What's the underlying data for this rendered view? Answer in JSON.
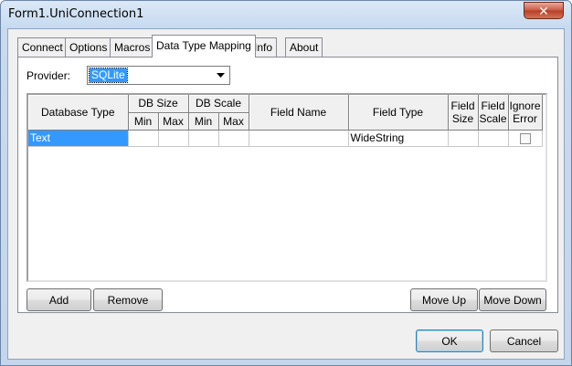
{
  "window": {
    "title": "Form1.UniConnection1",
    "close_symbol": "✕"
  },
  "tabs": [
    {
      "label": "Connect"
    },
    {
      "label": "Options"
    },
    {
      "label": "Macros"
    },
    {
      "label": "Data Type Mapping"
    },
    {
      "label": "Info"
    },
    {
      "label": "About"
    }
  ],
  "provider": {
    "label": "Provider:",
    "value": "SQLite"
  },
  "grid": {
    "headers": {
      "database_type": "Database Type",
      "db_size": "DB Size",
      "db_scale": "DB Scale",
      "min": "Min",
      "max": "Max",
      "field_name": "Field Name",
      "field_type": "Field Type",
      "field_size_1": "Field",
      "field_size_2": "Size",
      "field_scale_1": "Field",
      "field_scale_2": "Scale",
      "ignore_error_1": "Ignore",
      "ignore_error_2": "Error"
    },
    "rows": [
      {
        "database_type": "Text",
        "db_size_min": "",
        "db_size_max": "",
        "db_scale_min": "",
        "db_scale_max": "",
        "field_name": "",
        "field_type": "WideString",
        "field_size": "",
        "field_scale": "",
        "ignore_error": false
      }
    ]
  },
  "buttons": {
    "add": "Add",
    "remove": "Remove",
    "move_up": "Move Up",
    "move_down": "Move Down",
    "ok": "OK",
    "cancel": "Cancel"
  }
}
